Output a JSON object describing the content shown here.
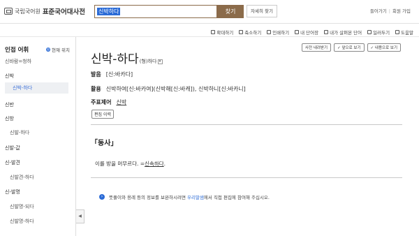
{
  "header": {
    "org": "국립국어원",
    "dict": "표준국어대사전",
    "search_value": "신박하다",
    "search_button": "찾기",
    "advanced_button": "자세히 찾기",
    "auth": {
      "login": "들어가기",
      "signup": "회원 가입"
    }
  },
  "toolbar": [
    "확대하기",
    "축소하기",
    "인쇄하기",
    "내 단어장",
    "내가 살펴본 단어",
    "일러두기",
    "도움말"
  ],
  "sidebar": {
    "title": "인접 어휘",
    "position_label": "현재 위치",
    "items": [
      {
        "label": "신바람=청하",
        "level": "sub"
      },
      {
        "label": "신박",
        "level": "main"
      },
      {
        "label": "신박-하다",
        "level": "active"
      },
      {
        "label": "신반",
        "level": "main"
      },
      {
        "label": "신방",
        "level": "main"
      },
      {
        "label": "신발-하다",
        "level": "sub"
      },
      {
        "label": "신발-값",
        "level": "main"
      },
      {
        "label": "신-발견",
        "level": "main"
      },
      {
        "label": "신발견-하다",
        "level": "sub"
      },
      {
        "label": "신-발명",
        "level": "main"
      },
      {
        "label": "신발명-되다",
        "level": "sub"
      },
      {
        "label": "신발명-하다",
        "level": "sub"
      }
    ]
  },
  "nav": {
    "print": "사전 내려받기",
    "prev": "앞으로 보기",
    "next": "내용으로 보기"
  },
  "entry": {
    "word": "신박-하다",
    "pos": "(형)",
    "pos_detail": "하다",
    "pronunciation_label": "발음",
    "pronunciation": "[신:바카다]",
    "conjugation_label": "활용",
    "conjugation": "신박하여[신:바카여](신박해[신:바캐]), 신박하니[신:바카니]",
    "root_label": "주표제어",
    "root": "신박",
    "edit_button": "편집 이력",
    "section": "「동사」",
    "definition": "이를 방을 머무르다. =",
    "definition_link": "신속하다"
  },
  "notice": {
    "text_before": "뜻풀이와 용례 등의 정보를 보완하시려면 ",
    "link": "우리말샘",
    "text_after": "에서 직접 편집에 참여해 주십시오."
  }
}
